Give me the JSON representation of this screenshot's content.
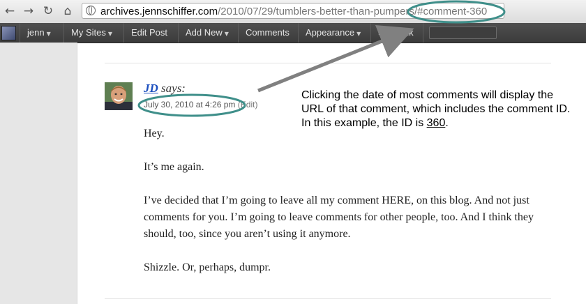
{
  "browser": {
    "back_icon": "←",
    "forward_icon": "→",
    "reload_icon": "↻",
    "home_icon": "⌂",
    "url_host": "archives.jennschiffer.com",
    "url_path": "/2010/07/29/tumblers-better-than-pumpers/#comment-360"
  },
  "admin_bar": {
    "user": "jenn",
    "items": [
      "My Sites",
      "Edit Post",
      "Add New",
      "Comments",
      "Appearance",
      "Shortlink"
    ]
  },
  "comment": {
    "author": "JD",
    "says": " says:",
    "date": "July 30, 2010 at 4:26 pm",
    "edit": "(Edit)",
    "paragraphs": [
      "Hey.",
      "It’s me again.",
      "I’ve decided that I’m going to leave all my comment HERE, on this blog. And not just comments for you. I’m going to leave comments for other people, too. And I think they should, too, since you aren’t using it anymore.",
      "Shizzle. Or, perhaps, dumpr."
    ]
  },
  "annotation": {
    "text": "Clicking the date of most comments will display the URL of that comment, which includes the comment ID.  In this example, the ID is ",
    "id_value": "360",
    "end": "."
  },
  "colors": {
    "highlight": "#3f8f8a",
    "arrow": "#808080",
    "link": "#1c4fbf"
  }
}
